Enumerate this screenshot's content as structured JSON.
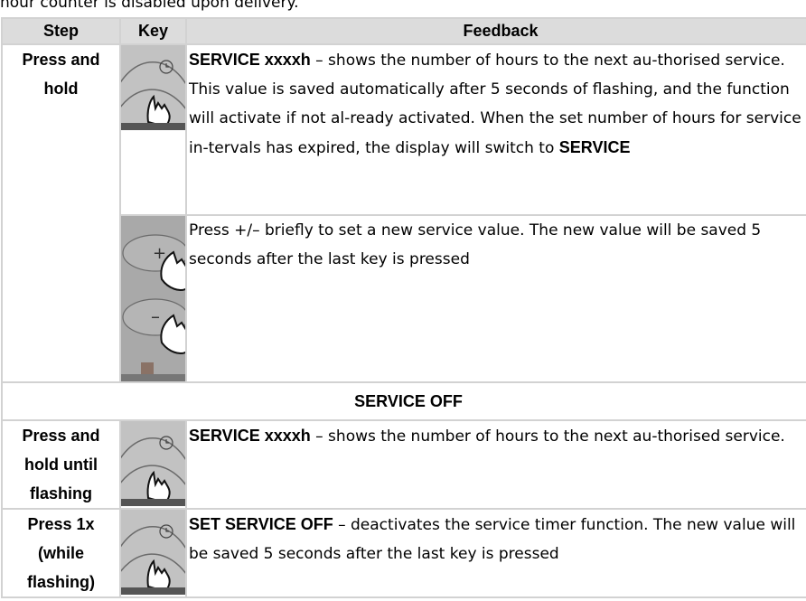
{
  "intro": "hour counter is disabled upon delivery.",
  "headers": {
    "step": "Step",
    "key": "Key",
    "feedback": "Feedback"
  },
  "rows": [
    {
      "step": "Press and hold",
      "icon": "clock-key-press-icon",
      "bold": "SERVICE xxxxh",
      "text": " – shows the number of hours to the next au-thorised service. This value is saved automatically after 5 seconds of flashing, and the function will activate if not al-ready activated. When the set number of hours for service in-tervals has expired, the display will switch to ",
      "bold2": "SERVICE"
    },
    {
      "icon": "plus-minus-keys-icon",
      "text": "Press +/– briefly to set a new service value. The new value will be saved 5 seconds after the last key is pressed"
    }
  ],
  "section_title": "SERVICE OFF",
  "rows2": [
    {
      "step": "Press and hold until flashing",
      "icon": "clock-key-press-icon",
      "bold": "SERVICE xxxxh",
      "text": " – shows the number of hours to the next au-thorised service."
    },
    {
      "step": "Press 1x (while flashing)",
      "icon": "clock-key-press-icon",
      "bold": "SET SERVICE OFF",
      "text": " – deactivates the service timer function. The new value will be saved 5 seconds after the last key is pressed"
    }
  ]
}
